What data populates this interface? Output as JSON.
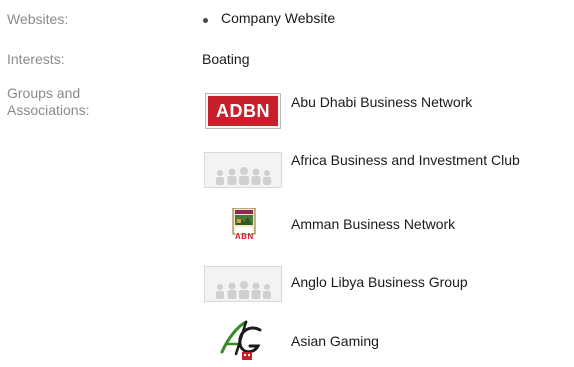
{
  "profile": {
    "websites_label": "Websites:",
    "websites": [
      "Company Website"
    ],
    "interests_label": "Interests:",
    "interests_value": "Boating",
    "groups_label_line1": "Groups and",
    "groups_label_line2": "Associations:",
    "groups": [
      {
        "name": "Abu Dhabi Business Network",
        "logo_text": "ADBN",
        "logo_color": "#c8202a"
      },
      {
        "name": "Africa Business and Investment Club",
        "logo": "group-placeholder-icon"
      },
      {
        "name": "Amman Business Network",
        "logo_text": "ABN",
        "logo_color": "#c8202a"
      },
      {
        "name": "Anglo Libya Business Group",
        "logo": "group-placeholder-icon"
      },
      {
        "name": "Asian Gaming",
        "logo_text": "AG"
      }
    ]
  }
}
